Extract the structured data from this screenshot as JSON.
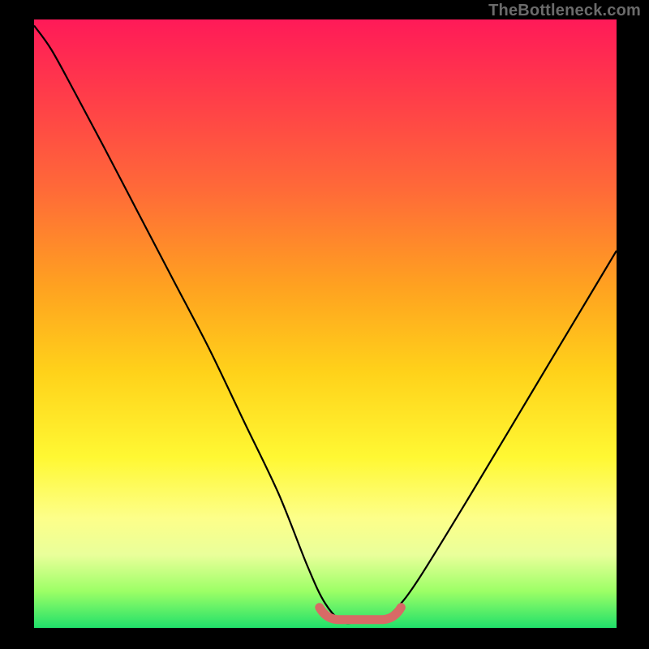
{
  "watermark": "TheBottleneck.com",
  "colors": {
    "background": "#000000",
    "curve": "#000000",
    "bottom_marker": "#d86a66",
    "gradient_top": "#ff1a58",
    "gradient_bottom": "#20e06a"
  },
  "chart_data": {
    "type": "line",
    "title": "",
    "xlabel": "",
    "ylabel": "",
    "xlim": [
      0,
      100
    ],
    "ylim": [
      0,
      100
    ],
    "series": [
      {
        "name": "curve",
        "x": [
          0,
          3,
          7,
          12,
          18,
          24,
          30,
          36,
          42,
          47,
          50,
          53,
          56,
          59,
          62,
          66,
          75,
          85,
          95,
          100
        ],
        "y": [
          99,
          95,
          88,
          79,
          68,
          57,
          46,
          34,
          22,
          10,
          4,
          1,
          1,
          1,
          3,
          8,
          22,
          38,
          54,
          62
        ]
      }
    ],
    "annotations": [
      {
        "name": "flat-bottom-marker",
        "x_start": 49,
        "x_end": 63,
        "y": 1.5
      }
    ]
  }
}
